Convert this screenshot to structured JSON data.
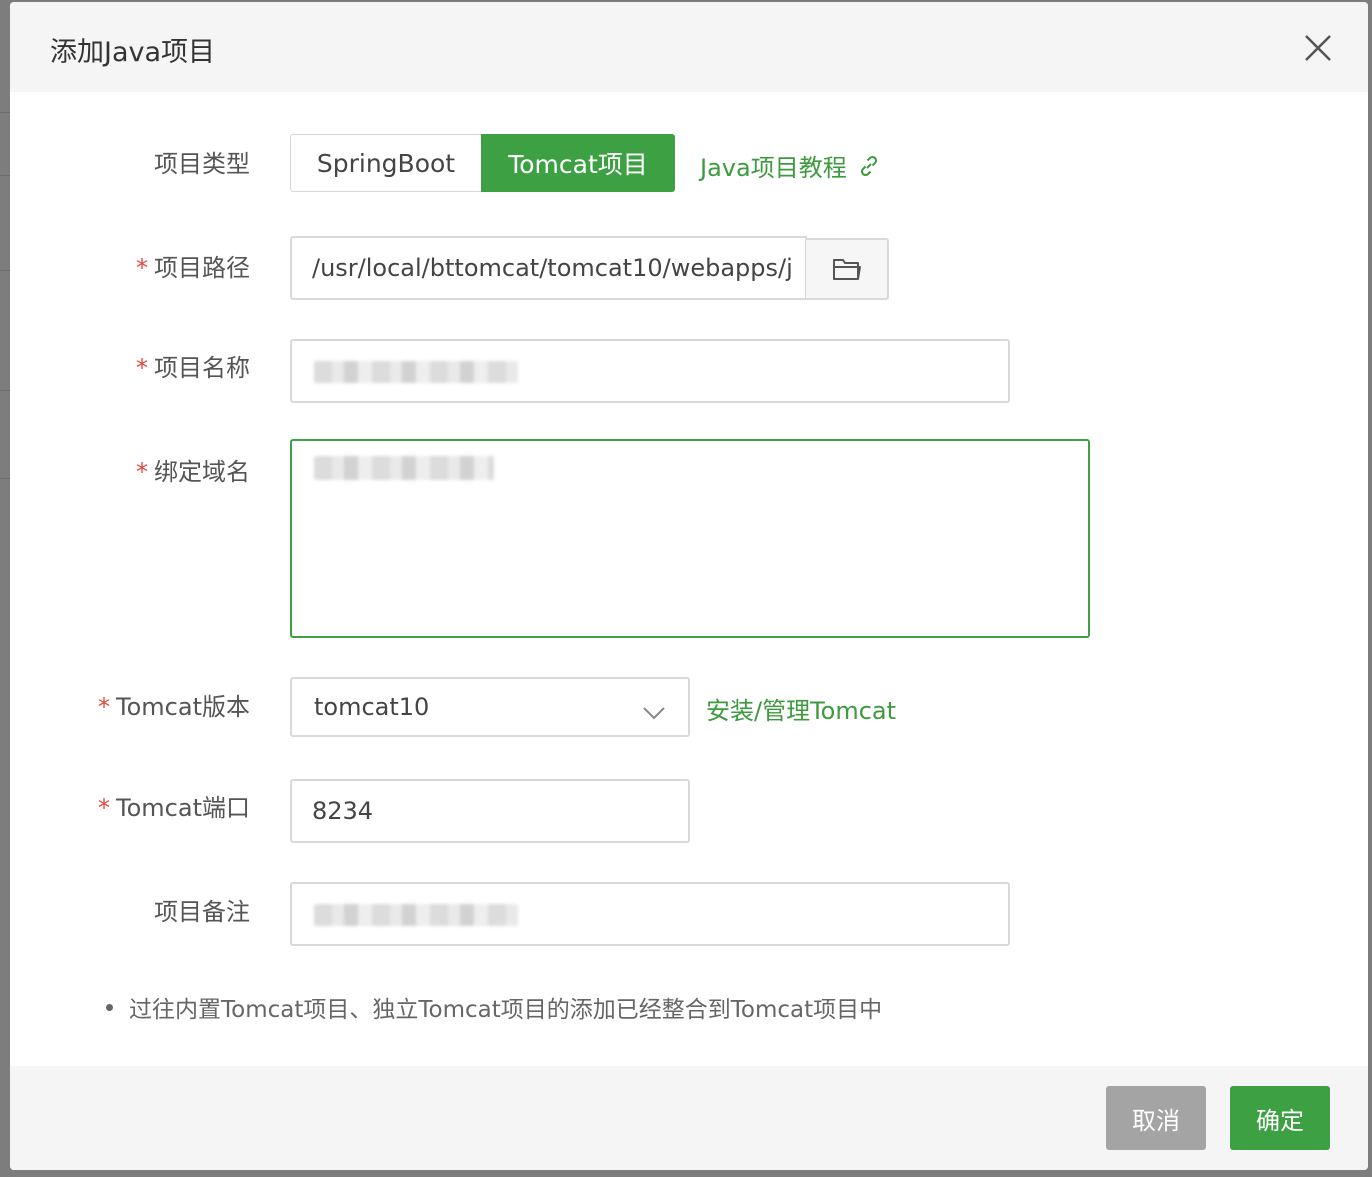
{
  "dialog": {
    "title": "添加Java项目"
  },
  "form": {
    "project_type": {
      "label": "项目类型",
      "options": [
        "SpringBoot",
        "Tomcat项目"
      ],
      "selected": "Tomcat项目",
      "tutorial_link": "Java项目教程"
    },
    "project_path": {
      "label": "项目路径",
      "value": "/usr/local/bttomcat/tomcat10/webapps/j"
    },
    "project_name": {
      "label": "项目名称"
    },
    "bind_domain": {
      "label": "绑定域名"
    },
    "tomcat_version": {
      "label": "Tomcat版本",
      "value": "tomcat10",
      "manage_link": "安装/管理Tomcat"
    },
    "tomcat_port": {
      "label": "Tomcat端口",
      "value": "8234"
    },
    "project_remark": {
      "label": "项目备注"
    }
  },
  "required_mark": "*",
  "note": "过往内置Tomcat项目、独立Tomcat项目的添加已经整合到Tomcat项目中",
  "footer": {
    "cancel_label": "取消",
    "confirm_label": "确定"
  },
  "colors": {
    "accent": "#3da043",
    "required": "#e5483d",
    "cancel": "#a4a4a4"
  }
}
